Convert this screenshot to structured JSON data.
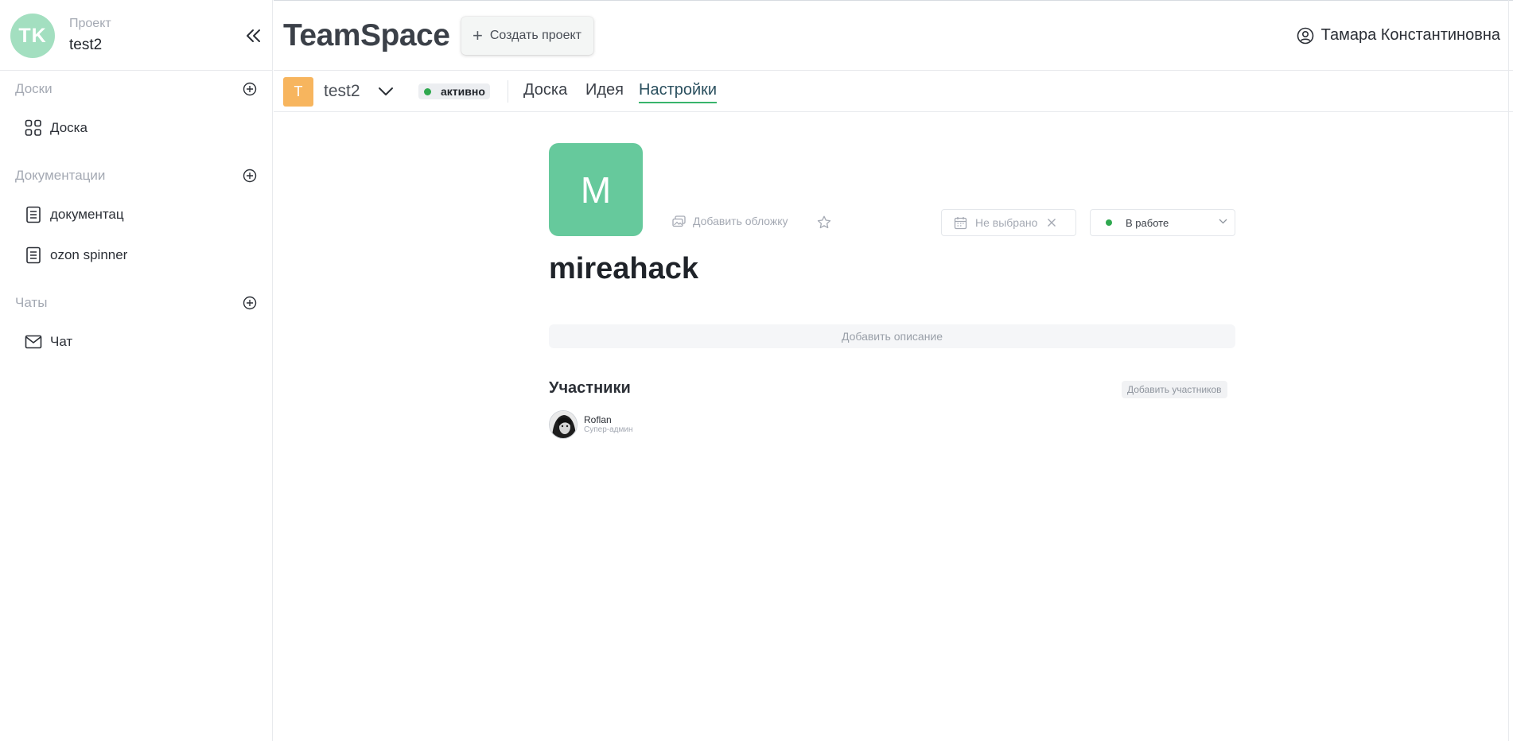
{
  "sidebar": {
    "avatar_initials": "TK",
    "project_label": "Проект",
    "project_name": "test2",
    "sections": {
      "boards": {
        "title": "Доски",
        "items": [
          {
            "label": "Доска",
            "icon": "grid-icon"
          }
        ]
      },
      "docs": {
        "title": "Документации",
        "items": [
          {
            "label": "документац",
            "icon": "document-icon"
          },
          {
            "label": "ozon spinner",
            "icon": "document-icon"
          }
        ]
      },
      "chats": {
        "title": "Чаты",
        "items": [
          {
            "label": "Чат",
            "icon": "mail-icon"
          }
        ]
      }
    }
  },
  "header": {
    "brand": "TeamSpace",
    "create_button": "Создать проект",
    "user_name": "Тамара Константиновна"
  },
  "subbar": {
    "project_badge": "T",
    "project_name": "test2",
    "status": "активно",
    "tabs": [
      {
        "label": "Доска"
      },
      {
        "label": "Идея"
      },
      {
        "label": "Настройки",
        "active": true
      }
    ]
  },
  "task": {
    "cover_letter": "M",
    "add_cover": "Добавить обложку",
    "date_placeholder": "Не выбрано",
    "stage": "В работе",
    "title": "mireahack",
    "description_placeholder": "Добавить описание",
    "members_title": "Участники",
    "add_members": "Добавить участников",
    "members": [
      {
        "name": "Roflan",
        "role": "Супер-админ"
      }
    ]
  },
  "colors": {
    "accent_green": "#66c99c",
    "status_green": "#2fa84f",
    "avatar_green": "#a3dfc0",
    "project_badge_orange": "#f7b55e",
    "tab_underline": "#38b46c"
  }
}
